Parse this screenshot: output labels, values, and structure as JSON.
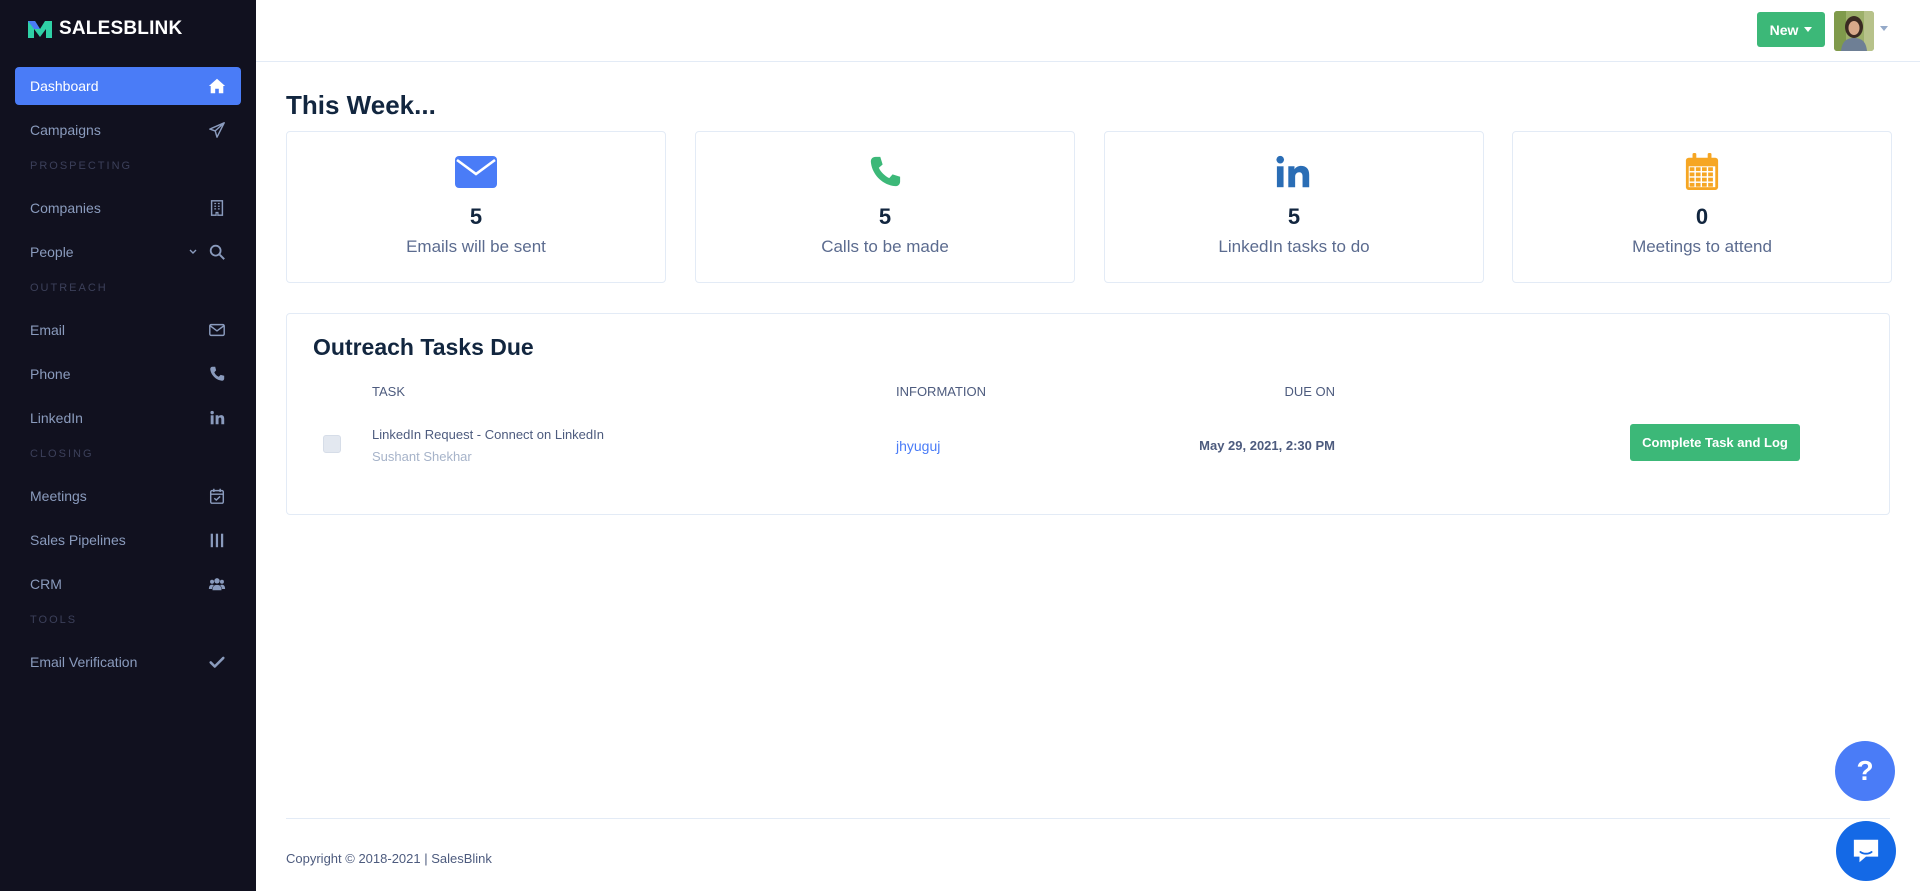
{
  "app": {
    "brand": "SALESBLINK"
  },
  "colors": {
    "sidebar_bg": "#11111f",
    "accent": "#4a7cf7",
    "success": "#3cb878",
    "phone": "#3cb878",
    "linkedin": "#2a6db5",
    "calendar": "#f6a623"
  },
  "sidebar": {
    "dashboard": {
      "label": "Dashboard",
      "icon": "home-icon"
    },
    "campaigns": {
      "label": "Campaigns",
      "icon": "paper-plane-icon"
    },
    "section_prospecting": "PROSPECTING",
    "companies": {
      "label": "Companies",
      "icon": "building-icon"
    },
    "people": {
      "label": "People",
      "icon": "search-icon"
    },
    "section_outreach": "OUTREACH",
    "email": {
      "label": "Email",
      "icon": "envelope-icon"
    },
    "phone": {
      "label": "Phone",
      "icon": "phone-icon"
    },
    "linkedin": {
      "label": "LinkedIn",
      "icon": "linkedin-icon"
    },
    "section_closing": "CLOSING",
    "meetings": {
      "label": "Meetings",
      "icon": "calendar-check-icon"
    },
    "pipelines": {
      "label": "Sales Pipelines",
      "icon": "columns-icon"
    },
    "crm": {
      "label": "CRM",
      "icon": "users-icon"
    },
    "section_tools": "TOOLS",
    "email_verification": {
      "label": "Email Verification",
      "icon": "check-icon"
    }
  },
  "header": {
    "new_button": "New"
  },
  "main": {
    "week_title": "This Week...",
    "stats": [
      {
        "value": "5",
        "label": "Emails will be sent",
        "icon": "envelope-icon"
      },
      {
        "value": "5",
        "label": "Calls to be made",
        "icon": "phone-icon"
      },
      {
        "value": "5",
        "label": "LinkedIn tasks to do",
        "icon": "linkedin-icon"
      },
      {
        "value": "0",
        "label": "Meetings to attend",
        "icon": "calendar-icon"
      }
    ],
    "tasks": {
      "title": "Outreach Tasks Due",
      "columns": {
        "task": "TASK",
        "information": "INFORMATION",
        "due_on": "DUE ON"
      },
      "rows": [
        {
          "task": "LinkedIn Request - Connect on LinkedIn",
          "person": "Sushant Shekhar",
          "information": "jhyuguj",
          "due": "May 29, 2021, 2:30 PM",
          "action": "Complete Task and Log"
        }
      ]
    }
  },
  "footer": {
    "copyright": "Copyright © 2018-2021 | SalesBlink"
  },
  "widgets": {
    "help": "?"
  }
}
